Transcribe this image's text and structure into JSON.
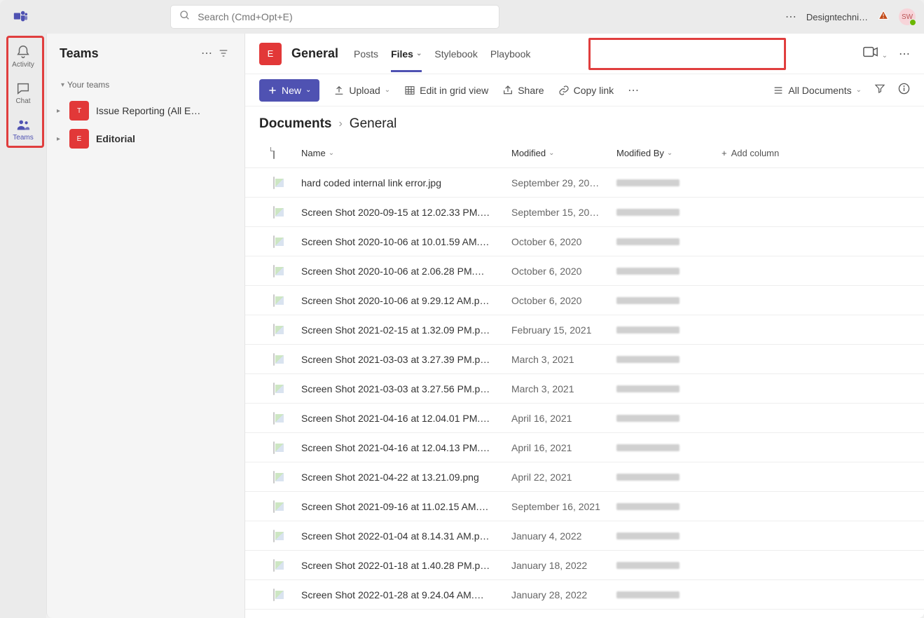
{
  "topbar": {
    "search_placeholder": "Search (Cmd+Opt+E)",
    "org_label": "Designtechni…",
    "avatar_initials": "SW"
  },
  "leftnav": [
    {
      "id": "activity",
      "label": "Activity"
    },
    {
      "id": "chat",
      "label": "Chat"
    },
    {
      "id": "teams",
      "label": "Teams"
    }
  ],
  "teams_panel": {
    "title": "Teams",
    "section_label": "Your teams",
    "items": [
      {
        "initial": "T",
        "name": "Issue Reporting (All E…",
        "bold": false
      },
      {
        "initial": "E",
        "name": "Editorial",
        "bold": true
      }
    ]
  },
  "channel": {
    "avatar_initial": "E",
    "title": "General",
    "tabs": [
      "Posts",
      "Files",
      "Stylebook",
      "Playbook"
    ],
    "active_tab_index": 1
  },
  "toolbar": {
    "new_label": "New",
    "upload_label": "Upload",
    "edit_grid_label": "Edit in grid view",
    "share_label": "Share",
    "copy_link_label": "Copy link",
    "view_label": "All Documents"
  },
  "breadcrumb": [
    "Documents",
    "General"
  ],
  "columns": {
    "name": "Name",
    "modified": "Modified",
    "modified_by": "Modified By",
    "add_column": "Add column"
  },
  "files": [
    {
      "name": "hard coded internal link error.jpg",
      "modified": "September 29, 20…"
    },
    {
      "name": "Screen Shot 2020-09-15 at 12.02.33 PM.…",
      "modified": "September 15, 20…"
    },
    {
      "name": "Screen Shot 2020-10-06 at 10.01.59 AM.…",
      "modified": "October 6, 2020"
    },
    {
      "name": "Screen Shot 2020-10-06 at 2.06.28 PM.…",
      "modified": "October 6, 2020"
    },
    {
      "name": "Screen Shot 2020-10-06 at 9.29.12 AM.p…",
      "modified": "October 6, 2020"
    },
    {
      "name": "Screen Shot 2021-02-15 at 1.32.09 PM.p…",
      "modified": "February 15, 2021"
    },
    {
      "name": "Screen Shot 2021-03-03 at 3.27.39 PM.p…",
      "modified": "March 3, 2021"
    },
    {
      "name": "Screen Shot 2021-03-03 at 3.27.56 PM.p…",
      "modified": "March 3, 2021"
    },
    {
      "name": "Screen Shot 2021-04-16 at 12.04.01 PM.…",
      "modified": "April 16, 2021"
    },
    {
      "name": "Screen Shot 2021-04-16 at 12.04.13 PM.…",
      "modified": "April 16, 2021"
    },
    {
      "name": "Screen Shot 2021-04-22 at 13.21.09.png",
      "modified": "April 22, 2021"
    },
    {
      "name": "Screen Shot 2021-09-16 at 11.02.15 AM.…",
      "modified": "September 16, 2021"
    },
    {
      "name": "Screen Shot 2022-01-04 at 8.14.31 AM.p…",
      "modified": "January 4, 2022"
    },
    {
      "name": "Screen Shot 2022-01-18 at 1.40.28 PM.p…",
      "modified": "January 18, 2022"
    },
    {
      "name": "Screen Shot 2022-01-28 at 9.24.04 AM.…",
      "modified": "January 28, 2022"
    }
  ]
}
